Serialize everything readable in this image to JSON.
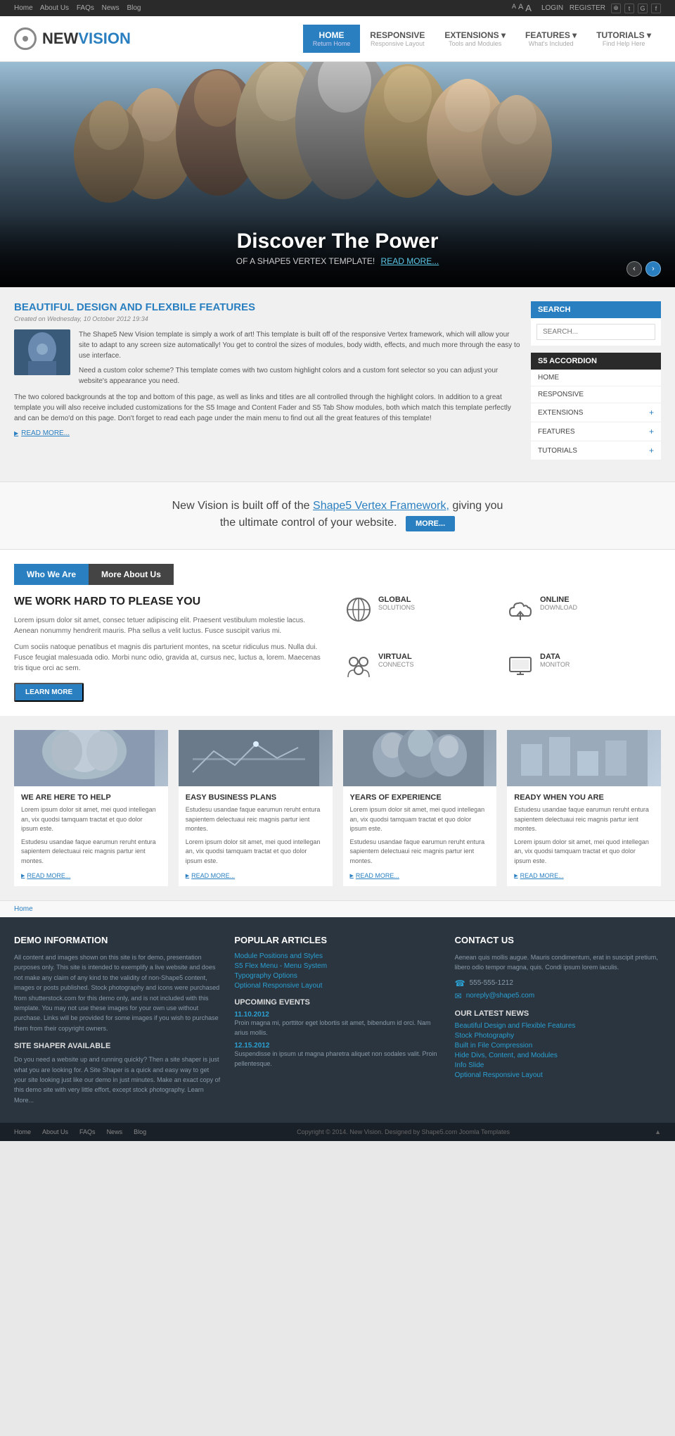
{
  "topbar": {
    "nav_links": [
      "Home",
      "About Us",
      "FAQs",
      "News",
      "Blog"
    ],
    "font_sizes": [
      "A",
      "A",
      "A"
    ],
    "auth_links": [
      "LOGIN",
      "REGISTER"
    ],
    "social": [
      "rss",
      "t",
      "G",
      "f"
    ]
  },
  "header": {
    "logo_new": "NEW",
    "logo_vision": "VISION",
    "nav": [
      {
        "label": "HOME",
        "sub": "Return Home",
        "active": true,
        "has_arrow": false
      },
      {
        "label": "RESPONSIVE",
        "sub": "Responsive Layout",
        "active": false,
        "has_arrow": false
      },
      {
        "label": "EXTENSIONS",
        "sub": "Tools and Modules",
        "active": false,
        "has_arrow": true
      },
      {
        "label": "FEATURES",
        "sub": "What's Included",
        "active": false,
        "has_arrow": true
      },
      {
        "label": "TUTORIALS",
        "sub": "Find Help Here",
        "active": false,
        "has_arrow": true
      }
    ]
  },
  "hero": {
    "title": "Discover The Power",
    "subtitle": "OF A SHAPE5 VERTEX TEMPLATE!",
    "read_more": "READ MORE...",
    "prev_btn": "‹",
    "next_btn": "›"
  },
  "main_article": {
    "title": "BEAUTIFUL DESIGN AND FLEXBILE FEATURES",
    "date": "Created on Wednesday, 10 October 2012 19:34",
    "text1": "The Shape5 New Vision template is simply a work of art! This template is built off of the responsive Vertex framework, which will allow your site to adapt to any screen size automatically! You get to control the sizes of modules, body width, effects, and much more through the easy to use interface.",
    "text2": "Need a custom color scheme? This template comes with two custom highlight colors and a custom font selector so you can adjust your website's appearance you need.",
    "text3": "The two colored backgrounds at the top and bottom of this page, as well as links and titles are all controlled through the highlight colors. In addition to a great template you will also receive included customizations for the S5 Image and Content Fader and S5 Tab Show modules, both which match this template perfectly and can be demo'd on this page. Don't forget to read each page under the main menu to find out all the great features of this template!",
    "read_more": "READ MORE..."
  },
  "sidebar": {
    "search_title": "SEARCH",
    "search_placeholder": "SEARCH...",
    "accordion_title": "S5 ACCORDION",
    "accordion_items": [
      {
        "label": "HOME",
        "has_plus": false
      },
      {
        "label": "RESPONSIVE",
        "has_plus": false
      },
      {
        "label": "EXTENSIONS",
        "has_plus": true
      },
      {
        "label": "FEATURES",
        "has_plus": true
      },
      {
        "label": "TUTORIALS",
        "has_plus": true
      }
    ]
  },
  "tagline": {
    "text": "New Vision is built off of the",
    "link_text": "Shape5 Vertex Framework,",
    "text2": "giving you",
    "text3": "the ultimate control of your website.",
    "btn_label": "MORE..."
  },
  "tabs": {
    "tab1": "Who We Are",
    "tab2": "More About Us",
    "heading": "WE WORK HARD TO PLEASE YOU",
    "para1": "Lorem ipsum dolor sit amet, consec tetuer adipiscing elit. Praesent vestibulum molestie lacus. Aenean nonummy hendrerit mauris. Pha sellus a velit luctus. Fusce suscipit varius mi.",
    "para2": "Cum sociis natoque penatibus et magnis dis parturient montes, na scetur ridiculus mus. Nulla dui. Fusce feugiat malesuada odio. Morbi nunc odio, gravida at, cursus nec, luctus a, lorem. Maecenas tris tique orci ac sem.",
    "learn_more": "LEARN MORE",
    "features": [
      {
        "icon": "🌐",
        "title": "GLOBAL",
        "subtitle": "SOLUTIONS"
      },
      {
        "icon": "☁",
        "title": "ONLINE",
        "subtitle": "DOWNLOAD"
      },
      {
        "icon": "👥",
        "title": "VIRTUAL",
        "subtitle": "CONNECTS"
      },
      {
        "icon": "🖥",
        "title": "DATA",
        "subtitle": "MONITOR"
      }
    ]
  },
  "cards": [
    {
      "title": "WE ARE HERE TO HELP",
      "text1": "Lorem ipsum dolor sit amet, mei quod intellegan an, vix quodsi tamquam tractat et quo dolor ipsum este.",
      "text2": "Estudesu usandae faque earumun reruht entura sapientem delectuaui reic magnis partur ient montes.",
      "read_more": "READ MORE..."
    },
    {
      "title": "EASY BUSINESS PLANS",
      "text1": "Estudesu usandae faque earumun reruht entura sapientem delectuaui reic magnis partur ient montes.",
      "text2": "Lorem ipsum dolor sit amet, mei quod intellegan an, vix quodsi tamquam tractat et quo dolor ipsum este.",
      "read_more": "READ MORE..."
    },
    {
      "title": "YEARS OF EXPERIENCE",
      "text1": "Lorem ipsum dolor sit amet, mei quod intellegan an, vix quodsi tamquam tractat et quo dolor ipsum este.",
      "text2": "Estudesu usandae faque earumun reruht entura sapientem delectuaui reic magnis partur ient montes.",
      "read_more": "READ MORE..."
    },
    {
      "title": "READY WHEN YOU ARE",
      "text1": "Estudesu usandae faque earumun reruht entura sapientem delectuaui reic magnis partur ient montes.",
      "text2": "Lorem ipsum dolor sit amet, mei quod intellegan an, vix quodsi tamquam tractat et quo dolor ipsum este.",
      "read_more": "READ MORE..."
    }
  ],
  "breadcrumb": "Home",
  "footer": {
    "col1": {
      "title": "DEMO INFORMATION",
      "text": "All content and images shown on this site is for demo, presentation purposes only. This site is intended to exemplify a live website and does not make any claim of any kind to the validity of non-Shape5 content, images or posts published. Stock photography and icons were purchased from shutterstock.com for this demo only, and is not included with this template. You may not use these images for your own use without purchase. Links will be provided for some images if you wish to purchase them from their copyright owners.",
      "subtitle": "SITE SHAPER AVAILABLE",
      "site_shaper_text": "Do you need a website up and running quickly? Then a site shaper is just what you are looking for. A Site Shaper is a quick and easy way to get your site looking just like our demo in just minutes. Make an exact copy of this demo site with very little effort, except stock photography. Learn More..."
    },
    "col2": {
      "title": "POPULAR ARTICLES",
      "links": [
        "Module Positions and Styles",
        "S5 Flex Menu - Menu System",
        "Typography Options",
        "Optional Responsive Layout"
      ],
      "events_title": "UPCOMING EVENTS",
      "events": [
        {
          "date": "11.10.2012",
          "text": "Proin magna mi, porttitor eget lobortis sit amet, bibendum id orci. Nam arius mollis."
        },
        {
          "date": "12.15.2012",
          "text": "Suspendisse in ipsum ut magna pharetra aliquet non sodales valit. Proin pellentesque."
        }
      ]
    },
    "col3": {
      "title": "CONTACT US",
      "text": "Aenean quis mollis augue. Mauris condimentum, erat in suscipit pretium, libero odio tempor magna, quis. Condi ipsum lorem iaculis.",
      "phone": "555-555-1212",
      "email": "noreply@shape5.com",
      "news_title": "OUR LATEST NEWS",
      "news_links": [
        "Beautiful Design and Flexible Features",
        "Stock Photography",
        "Built in File Compression",
        "Hide Divs, Content, and Modules",
        "Info Slide",
        "Optional Responsive Layout"
      ]
    }
  },
  "footer_bottom": {
    "nav_links": [
      "Home",
      "About Us",
      "FAQs",
      "News",
      "Blog"
    ],
    "copyright": "Copyright © 2014. New Vision. Designed by Shape5.com Joomla Templates"
  }
}
